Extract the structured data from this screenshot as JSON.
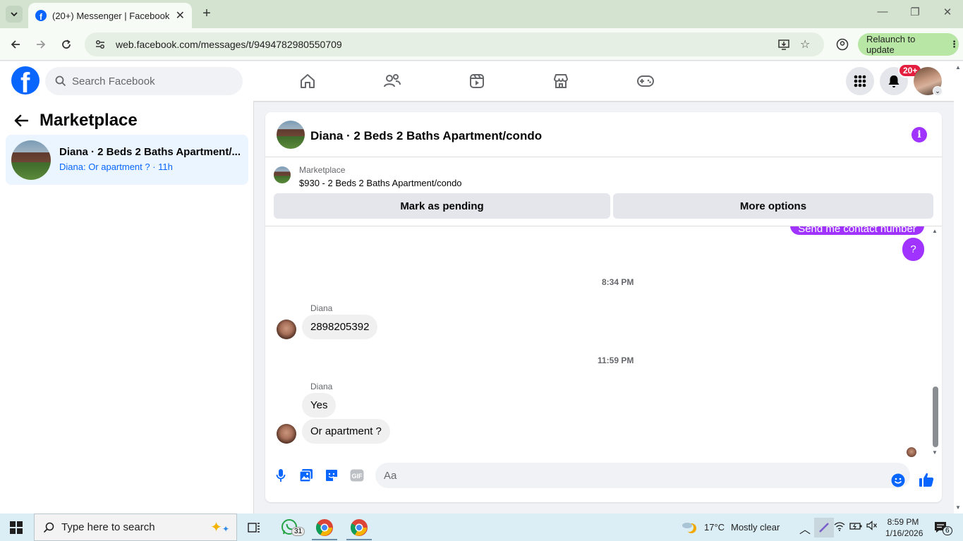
{
  "browser": {
    "tab_title": "(20+) Messenger | Facebook",
    "url": "web.facebook.com/messages/t/9494782980550709",
    "relaunch_label": "Relaunch to update"
  },
  "fbnav": {
    "search_placeholder": "Search Facebook",
    "notification_badge": "20+",
    "icons": [
      "home-icon",
      "friends-icon",
      "video-icon",
      "marketplace-icon",
      "gaming-icon",
      "menu-grid-icon",
      "bell-icon"
    ]
  },
  "sidebar": {
    "title": "Marketplace",
    "conversations": [
      {
        "name": "Diana · 2 Beds 2 Baths Apartment/...",
        "preview": "Diana: Or apartment ? · 11h"
      }
    ]
  },
  "chat": {
    "title": "Diana · 2 Beds 2 Baths Apartment/condo",
    "marketplace_label": "Marketplace",
    "listing": "$930 - 2 Beds 2 Baths Apartment/condo",
    "mark_pending_label": "Mark as pending",
    "more_options_label": "More options",
    "messages": {
      "out_cut": "Send me contact number",
      "out_q": "?",
      "ts1": "8:34 PM",
      "sender1": "Diana",
      "in1": "2898205392",
      "ts2": "11:59 PM",
      "sender2": "Diana",
      "in2": "Yes",
      "in3": "Or apartment ?"
    },
    "composer_placeholder": "Aa",
    "gif_label": "GIF"
  },
  "taskbar": {
    "search_placeholder": "Type here to search",
    "whatsapp_badge": "31",
    "weather_temp": "17°C",
    "weather_desc": "Mostly clear",
    "time": "8:59 PM",
    "date": "1/16/2026",
    "notification_count": "6"
  },
  "colors": {
    "fb_blue": "#0866ff",
    "messenger_purple": "#a033ff",
    "badge_red": "#e41e3f",
    "selected_conv": "#ebf5ff"
  }
}
